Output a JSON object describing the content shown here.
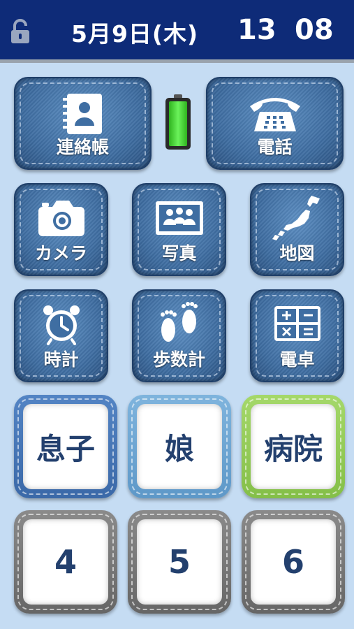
{
  "status": {
    "date": "5月9日(木)",
    "hour": "13",
    "minute": "08",
    "lock_icon": "unlocked-padlock-icon"
  },
  "apps": {
    "contacts": "連絡帳",
    "phone": "電話",
    "camera": "カメラ",
    "photos": "写真",
    "map": "地図",
    "clock": "時計",
    "pedometer": "歩数計",
    "calculator": "電卓"
  },
  "battery": {
    "level": 1.0,
    "color": "#36d12a"
  },
  "speed_dial": {
    "son": "息子",
    "daughter": "娘",
    "hospital": "病院",
    "slot4": "4",
    "slot5": "5",
    "slot6": "6"
  },
  "colors": {
    "header": "#0e2b78",
    "background": "#c5dcf3",
    "denim": "#3f6ea2",
    "tile_text": "#23406e"
  }
}
